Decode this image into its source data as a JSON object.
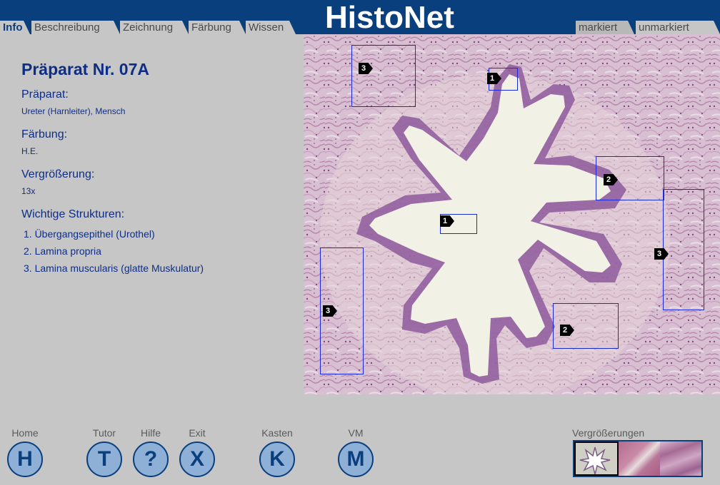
{
  "app": {
    "logo": "HistoNet"
  },
  "tabs_left": [
    {
      "label": "Info",
      "active": true
    },
    {
      "label": "Beschreibung",
      "active": false
    },
    {
      "label": "Zeichnung",
      "active": false
    },
    {
      "label": "Färbung",
      "active": false
    },
    {
      "label": "Wissen",
      "active": false
    }
  ],
  "tabs_right": [
    {
      "label": "markiert",
      "pressed": true
    },
    {
      "label": "unmarkiert",
      "pressed": false
    }
  ],
  "info": {
    "title": "Präparat Nr. 07A",
    "preparat_label": "Präparat:",
    "preparat_value": "Ureter (Harnleiter), Mensch",
    "staining_label": "Färbung:",
    "staining_value": "H.E.",
    "magnification_label": "Vergrößerung:",
    "magnification_value": "13x",
    "structures_label": "Wichtige Strukturen:",
    "structures": [
      "1. Übergangsepithel (Urothel)",
      "2. Lamina propria",
      "3. Lamina muscularis (glatte Muskulatur)"
    ]
  },
  "markers": [
    "3",
    "1",
    "2",
    "1",
    "3",
    "3",
    "2"
  ],
  "nav": [
    {
      "label": "Home",
      "letter": "H"
    },
    {
      "label": "Tutor",
      "letter": "T"
    },
    {
      "label": "Hilfe",
      "letter": "?"
    },
    {
      "label": "Exit",
      "letter": "X"
    },
    {
      "label": "Kasten",
      "letter": "K"
    },
    {
      "label": "VM",
      "letter": "M"
    }
  ],
  "magnifications_label": "Vergrößerungen",
  "colors": {
    "brand": "#0a3f7d",
    "text_blue": "#0e2e86",
    "roi_blue": "#1a2bd6",
    "background": "#c6c6c6"
  }
}
